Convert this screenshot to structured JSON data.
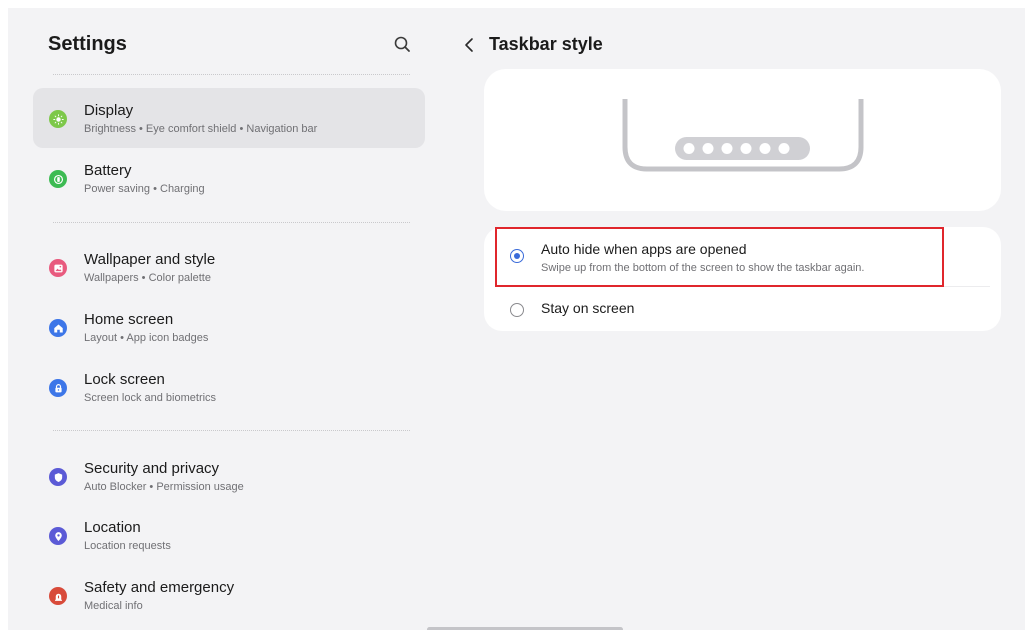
{
  "sidebar": {
    "title": "Settings",
    "items": [
      {
        "id": "display",
        "title": "Display",
        "subtitle": "Brightness  •  Eye comfort shield  •  Navigation bar",
        "icon": "sun-icon",
        "color": "#7dc84a",
        "selected": true
      },
      {
        "id": "battery",
        "title": "Battery",
        "subtitle": "Power saving  •  Charging",
        "icon": "battery-icon",
        "color": "#3dbb53",
        "selected": false
      },
      {
        "id": "wallpaper",
        "title": "Wallpaper and style",
        "subtitle": "Wallpapers  •  Color palette",
        "icon": "image-icon",
        "color": "#e85a7e",
        "selected": false
      },
      {
        "id": "home-screen",
        "title": "Home screen",
        "subtitle": "Layout  •  App icon badges",
        "icon": "home-icon",
        "color": "#3d76e8",
        "selected": false
      },
      {
        "id": "lock-screen",
        "title": "Lock screen",
        "subtitle": "Screen lock and biometrics",
        "icon": "lock-icon",
        "color": "#3d76e8",
        "selected": false
      },
      {
        "id": "security",
        "title": "Security and privacy",
        "subtitle": "Auto Blocker  •  Permission usage",
        "icon": "shield-icon",
        "color": "#5b5ad6",
        "selected": false
      },
      {
        "id": "location",
        "title": "Location",
        "subtitle": "Location requests",
        "icon": "location-pin-icon",
        "color": "#5b5ad6",
        "selected": false
      },
      {
        "id": "safety",
        "title": "Safety and emergency",
        "subtitle": "Medical info",
        "icon": "emergency-icon",
        "color": "#d84a3a",
        "selected": false
      }
    ]
  },
  "detail": {
    "title": "Taskbar style",
    "options": [
      {
        "title": "Auto hide when apps are opened",
        "subtitle": "Swipe up from the bottom of the screen to show the taskbar again.",
        "checked": true
      },
      {
        "title": "Stay on screen",
        "subtitle": "",
        "checked": false
      }
    ]
  },
  "colors": {
    "accent": "#3a6bd9",
    "highlight": "#e0262c",
    "background": "#f3f3f5"
  }
}
